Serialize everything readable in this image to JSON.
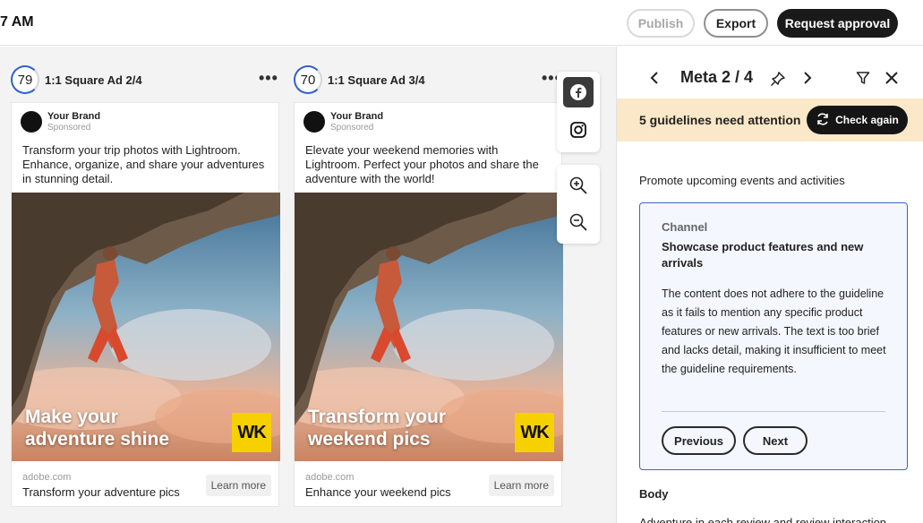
{
  "topbar": {
    "time": "7 AM",
    "publish_label": "Publish",
    "export_label": "Export",
    "approval_label": "Request approval"
  },
  "ads": [
    {
      "score": "79",
      "title": "1:1 Square Ad 2/4",
      "brand": "Your Brand",
      "sponsored": "Sponsored",
      "copy": "Transform your trip photos with Lightroom. Enhance, organize, and share your adventures in stunning detail.",
      "overlay": "Make your adventure shine",
      "logo": "WK",
      "domain": "adobe.com",
      "headline": "Transform your adventure pics",
      "cta": "Learn more"
    },
    {
      "score": "70",
      "title": "1:1 Square Ad 3/4",
      "brand": "Your Brand",
      "sponsored": "Sponsored",
      "copy": "Elevate your weekend memories with Lightroom. Perfect your photos and share the adventure with the world!",
      "overlay": "Transform your weekend pics",
      "logo": "WK",
      "domain": "adobe.com",
      "headline": "Enhance your weekend pics",
      "cta": "Learn more"
    }
  ],
  "more_icon": "•••",
  "toolbar": {
    "platforms": [
      "facebook-icon",
      "instagram-icon"
    ],
    "zoom": [
      "zoom-in-icon",
      "zoom-out-icon"
    ]
  },
  "panel": {
    "title": "Meta 2 / 4",
    "banner_text": "5 guidelines need attention",
    "check_again_label": "Check again",
    "intro": "Promote upcoming events and activities",
    "card": {
      "channel": "Channel",
      "heading": "Showcase product features and new arrivals",
      "body": "The content does not adhere to the guideline as it fails to mention any specific product features or new arrivals. The text is too brief and lacks detail, making it insufficient to meet the guideline requirements.",
      "previous_label": "Previous",
      "next_label": "Next"
    },
    "body_label": "Body",
    "body_cut": "Adventure in each review and review interaction"
  },
  "colors": {
    "accent_blue": "#3f64c8",
    "banner": "#fbe8c8",
    "logo_yellow": "#f7d000",
    "primary_dark": "#1a1a1a"
  }
}
